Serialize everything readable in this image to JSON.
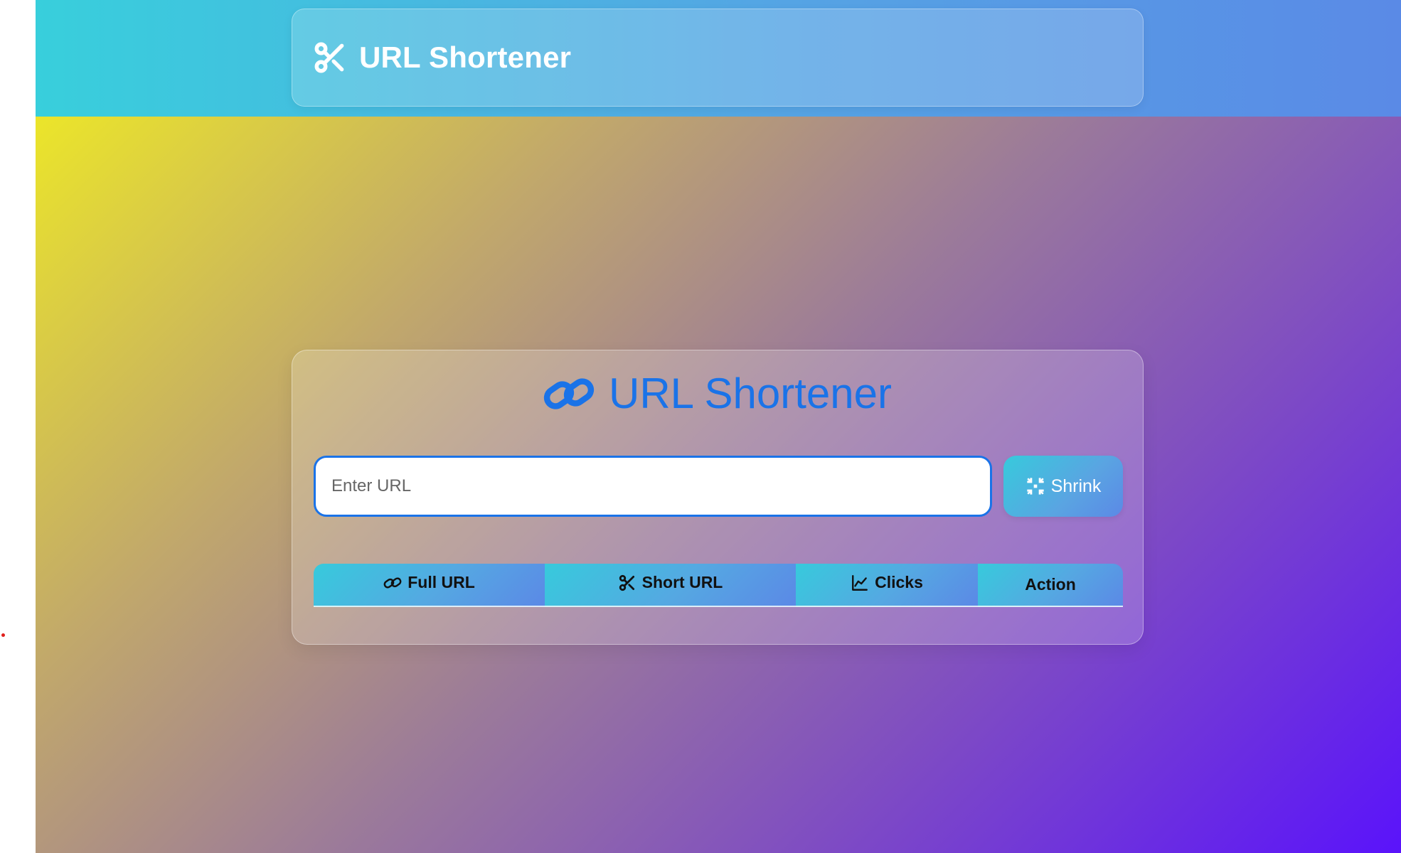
{
  "header": {
    "brand_title": "URL Shortener",
    "brand_icon": "scissors-icon"
  },
  "main": {
    "title": "URL Shortener",
    "title_icon": "link-icon",
    "url_input": {
      "placeholder": "Enter URL",
      "value": ""
    },
    "shrink_button": {
      "label": "Shrink",
      "icon": "compress-icon"
    },
    "table": {
      "columns": [
        {
          "label": "Full URL",
          "icon": "link-icon"
        },
        {
          "label": "Short URL",
          "icon": "scissors-icon"
        },
        {
          "label": "Clicks",
          "icon": "chart-line-icon"
        },
        {
          "label": "Action",
          "icon": ""
        }
      ],
      "rows": []
    }
  },
  "colors": {
    "accent": "#1a73e8",
    "header_gradient": [
      "#38cfdc",
      "#5a8ae6"
    ],
    "background_gradient": [
      "#f4f21c",
      "#5a13fb"
    ]
  }
}
